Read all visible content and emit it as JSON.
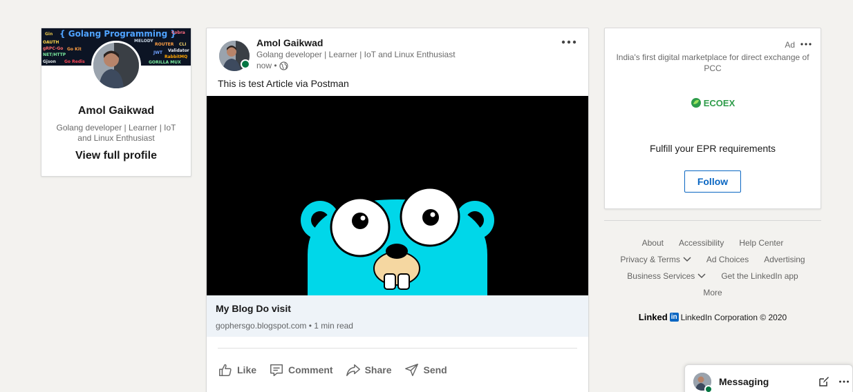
{
  "profile": {
    "banner_title": "{ Golang Programming }",
    "banner_tags": [
      "Gin",
      "OAUTH",
      "gRPC-Go",
      "Go Kit",
      "NET/HTTP",
      "Gjson",
      "Go Redis",
      "MELODY",
      "ROUTER",
      "JWT",
      "Validator",
      "RabbitMQ",
      "GORILLA MUX",
      "Cobra",
      "CLI"
    ],
    "name": "Amol Gaikwad",
    "headline": "Golang developer | Learner | IoT and Linux Enthusiast",
    "view_profile": "View full profile"
  },
  "post": {
    "author": "Amol Gaikwad",
    "headline": "Golang developer | Learner | IoT and Linux Enthusiast",
    "time": "now •",
    "text": "This is test Article via Postman",
    "link_title": "My Blog Do visit",
    "link_sub": "gophersgo.blogspot.com • 1 min read",
    "actions": {
      "like": "Like",
      "comment": "Comment",
      "share": "Share",
      "send": "Send"
    }
  },
  "ad": {
    "label": "Ad",
    "description": "India's first digital marketplace for direct exchange of PCC",
    "brand": "ECOEX",
    "tagline": "Fulfill your EPR requirements",
    "follow": "Follow"
  },
  "footer": {
    "about": "About",
    "accessibility": "Accessibility",
    "help_center": "Help Center",
    "privacy_terms": "Privacy & Terms",
    "ad_choices": "Ad Choices",
    "advertising": "Advertising",
    "business_services": "Business Services",
    "get_app": "Get the LinkedIn app",
    "more": "More",
    "brand_word": "Linked",
    "brand_box": "in",
    "copyright": "LinkedIn Corporation © 2020"
  },
  "messaging": {
    "title": "Messaging"
  },
  "colors": {
    "accent": "#0a66c2",
    "online": "#057642",
    "gopher": "#00d7e9",
    "page_bg": "#f3f2ef"
  },
  "icons": [
    "more-dots-icon",
    "globe-icon",
    "like-icon",
    "comment-icon",
    "share-icon",
    "send-icon",
    "compose-icon",
    "chevron-down-icon",
    "ecoex-leaf-icon"
  ]
}
